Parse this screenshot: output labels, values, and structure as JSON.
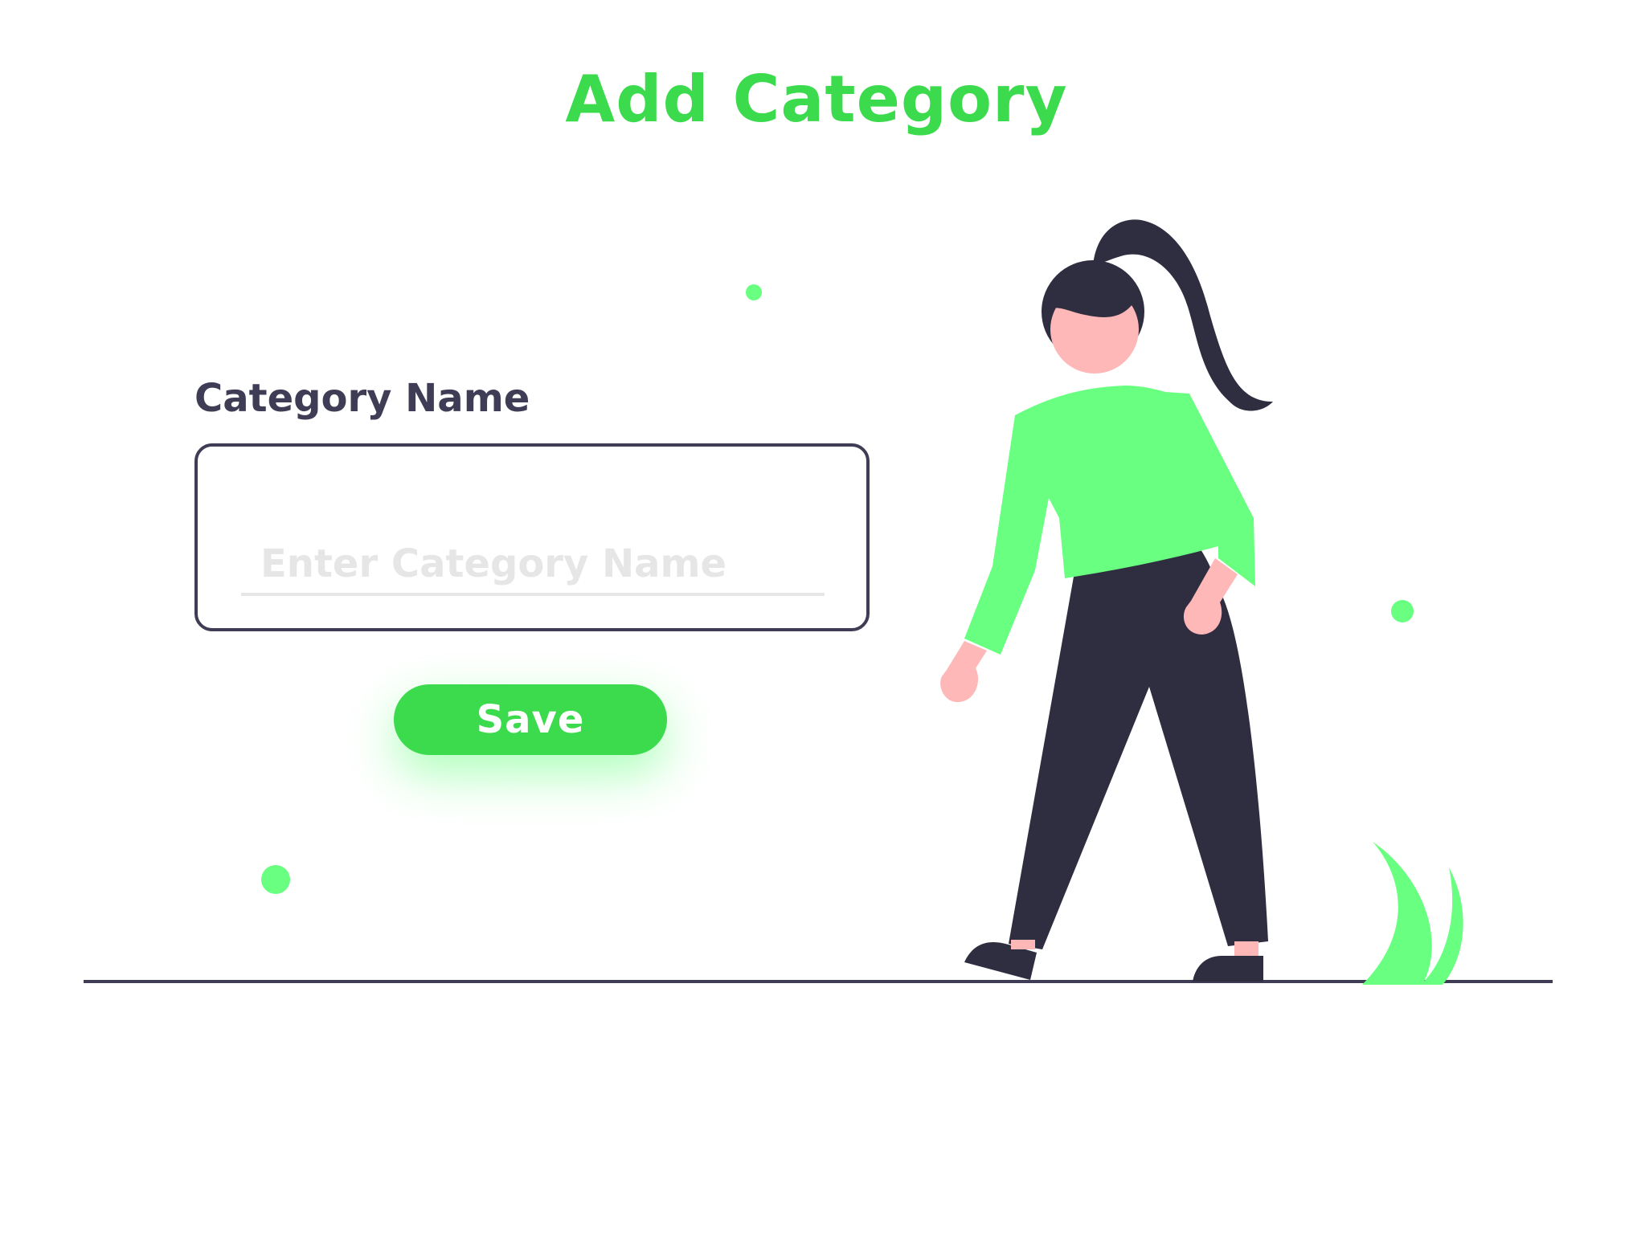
{
  "page": {
    "title": "Add Category"
  },
  "form": {
    "label": "Category Name",
    "input_placeholder": "Enter Category Name",
    "input_value": "",
    "save_label": "Save"
  },
  "colors": {
    "accent": "#3bdb4d",
    "light_green": "#69ff81",
    "dark": "#3f3d56",
    "muted": "#e6e6e6"
  },
  "illustration": {
    "description_icon": "person-walking-illustration"
  }
}
